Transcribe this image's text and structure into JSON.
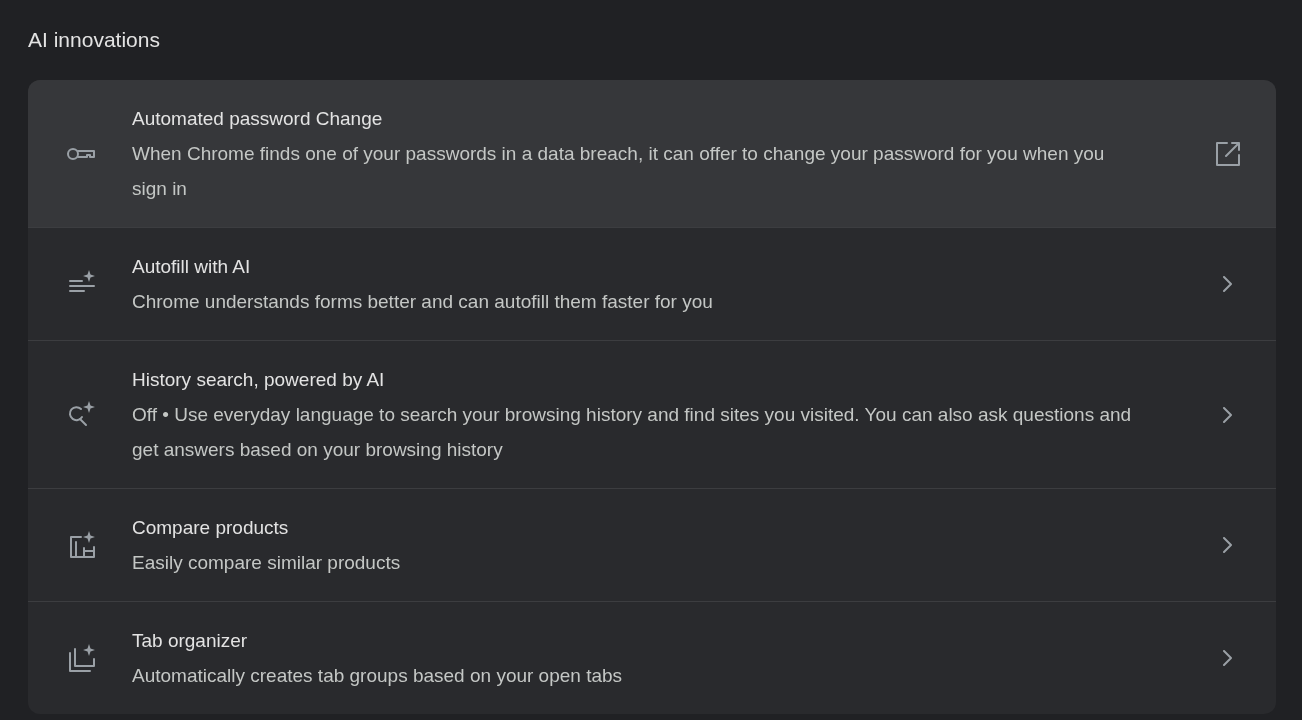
{
  "section_title": "AI innovations",
  "rows": [
    {
      "title": "Automated password Change",
      "description": "When Chrome finds one of your passwords in a data breach, it can offer to change your password for you when you sign in",
      "kind": "external",
      "highlighted": true
    },
    {
      "title": "Autofill with AI",
      "description": "Chrome understands forms better and can autofill them faster for you",
      "kind": "subpage",
      "highlighted": false
    },
    {
      "title": "History search, powered by AI",
      "description": "Off • Use everyday language to search your browsing history and find sites you visited. You can also ask questions and get answers based on your browsing history",
      "kind": "subpage",
      "highlighted": false
    },
    {
      "title": "Compare products",
      "description": "Easily compare similar products",
      "kind": "subpage",
      "highlighted": false
    },
    {
      "title": "Tab organizer",
      "description": "Automatically creates tab groups based on your open tabs",
      "kind": "subpage",
      "highlighted": false
    }
  ]
}
